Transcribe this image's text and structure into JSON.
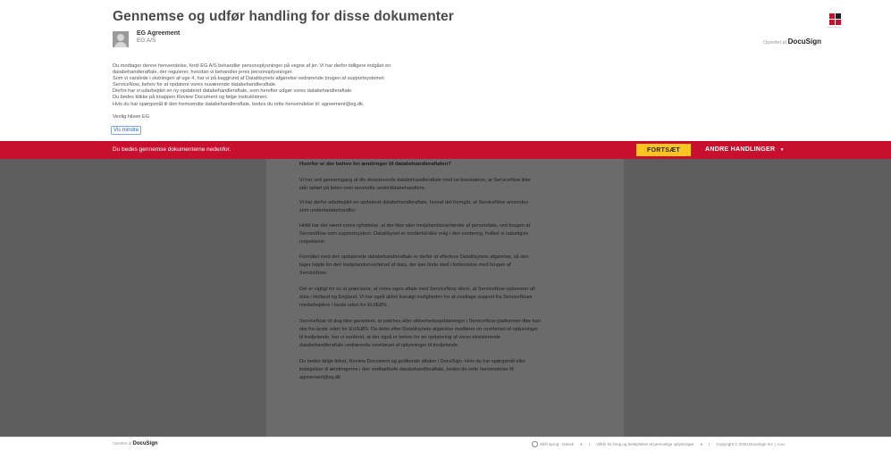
{
  "header": {
    "title": "Gennemse og udfør handling for disse dokumenter",
    "powered_by_prefix": "Oprettet af",
    "powered_by_brand": "DocuSign",
    "brand_colors": [
      "#c8102e",
      "#1f1f1f",
      "#c8102e",
      "#c8102e"
    ]
  },
  "sender": {
    "name": "EG Agreement",
    "org": "EG A/S"
  },
  "message": {
    "lines": [
      "Du modtager denne henvendelse, fordi EG A/S behandler personoplysninger på vegne af jer. Vi har derfor tidligere indgået en",
      "databehandleraftale, der regulerer, hvordan vi behandler jeres personoplysninger.",
      "Som vi varslede i slutningen af uge 4, har vi på baggrund af Datatilsynets afgørelse vedrørende brugen af supportsystemet",
      "ServiceNow, behov for at opdatere vores nuværende databehandleraftale.",
      "Derfor har vi udarbejdet en ny opdateret databehandleraftale, som herefter udgør vores databehandleraftale.",
      "Du bedes klikke på knappen Review Document og følge instruktionen.",
      "Hvis du har spørgsmål til den fremsendte databehandleraftale, bedes du rette henvendelse til: agreement@eg.dk"
    ],
    "signoff_1": "Venlig hilsen EG",
    "signoff_2": "Vis mindre"
  },
  "action_bar": {
    "instruction": "Du bedes gennemse dokumenterne nedenfor.",
    "continue_label": "FORTSÆT",
    "other_actions_label": "ANDRE HANDLINGER",
    "other_actions_icon": "caret-down-icon"
  },
  "document": {
    "heading": "Hvorfor er der behov for ændringer til databehandleraftalen?",
    "paragraphs": [
      {
        "lines": [
          "Vi har ved gennemgang af din eksisterende databehandleraftale med os konstateret, at ServiceNow ikke",
          "står opført på listen over anvendte underdatabehandlere."
        ]
      },
      {
        "lines": [
          "Vi har derfor udarbejdet en opdateret databehandleraftale, hvoraf det fremgår, at ServiceNow anvendes",
          "som underdatabehandler."
        ]
      },
      {
        "lines": [
          "Hidtil har det været vores opfattelse, at der ikke sker tredjelandsoverførsler af persondata, ved brugen af",
          "ServiceNow som supportsystem. Datatilsynet er imidlertid ikke enig i den vurdering, hvilket vi naturligvis",
          "respekterer."
        ]
      },
      {
        "lines": [
          "Formålet med den opdaterede databehandleraftale er derfor at efterleve Datatilsynets afgørelse, så den",
          "tager højde for den tredjelandsoverførsel af data, der kan finde sted i forbindelse med brugen af",
          "ServiceNow."
        ]
      },
      {
        "lines": [
          "Det er vigtigt for os at præcisere, at vores egen aftale med ServiceNow sikrer, at ServiceNow opbevarer alt",
          "data i Holland og England. Vi har også aktivt fravalgt muligheden for at modtage support fra ServiceNows",
          "medarbejdere i lande uden for EU/EØS."
        ]
      },
      {
        "lines": [
          "ServiceNow vil dog ikke garantere, at patches eller sikkerhedsopdateringer i ServiceNow-platformen ikke kan",
          "ske fra lande uden for EU/EØS. Da dette efter Datatilsynets afgørelse medfører en overførsel af oplysninger",
          "til tredjelande, har vi vurderet, at der også er behov for en opdatering af vores eksisterende",
          "databehandleraftale vedrørende overførsel af oplysninger til tredjelande."
        ]
      },
      {
        "lines": [
          "Du bedes følge linket, Review Document og godkende aftalen i DocuSign. Hvis du har spørgsmål eller",
          "indsigelser til ændringerne i den vedhæftede databehandleraftale, bedes du rette henvendelse til:",
          "agreement@eg.dk"
        ]
      }
    ]
  },
  "footer": {
    "powered_by_prefix": "Oprettet af",
    "powered_by_brand": "DocuSign",
    "language": "Skift sprog - Dansk",
    "terms": "Vilkår for brug og beskyttelse af personlige oplysninger",
    "copyright": "Copyright © 2020 DocuSign Inc. | v.oo"
  }
}
